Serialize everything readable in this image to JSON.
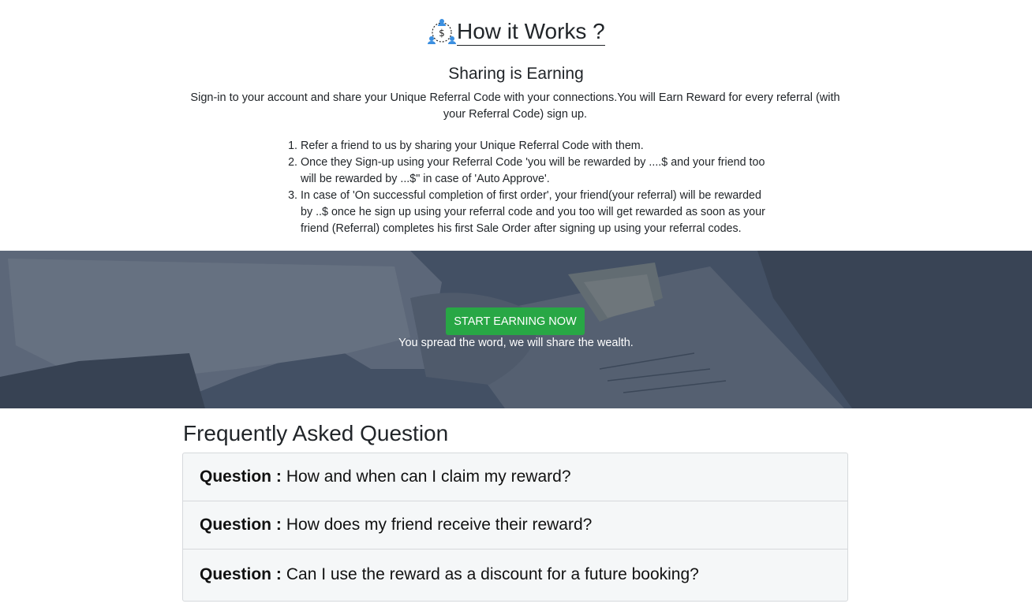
{
  "how": {
    "title": "How it Works ?",
    "subtitle": "Sharing is Earning",
    "description": "Sign-in to your account and share your Unique Referral Code with your connections.You will Earn Reward for every referral (with your Referral Code) sign up.",
    "steps": [
      "Refer a friend to us by sharing your Unique Referral Code with them.",
      "Once they Sign-up using your Referral Code 'you will be rewarded by ....$ and your friend too will be rewarded by ...$\" in case of 'Auto Approve'.",
      "In case of 'On successful completion of first order', your friend(your referral) will be rewarded by ..$ once he sign up using your referral code and you too will get rewarded as soon as your friend (Referral) completes his first Sale Order after signing up using your referral codes."
    ]
  },
  "hero": {
    "cta_label": "START EARNING NOW",
    "tagline": "You spread the word, we will share the wealth."
  },
  "faq": {
    "title": "Frequently Asked Question",
    "question_prefix": "Question :",
    "items": [
      {
        "question": "How and when can I claim my reward?"
      },
      {
        "question": "How does my friend receive their reward?"
      },
      {
        "question": "Can I use the reward as a discount for a future booking?"
      }
    ]
  },
  "colors": {
    "cta": "#28a745",
    "hero_overlay": "#4a5869",
    "icon_blue": "#3b8fe0"
  },
  "icons": {
    "title_icon": "referral-money-icon"
  }
}
